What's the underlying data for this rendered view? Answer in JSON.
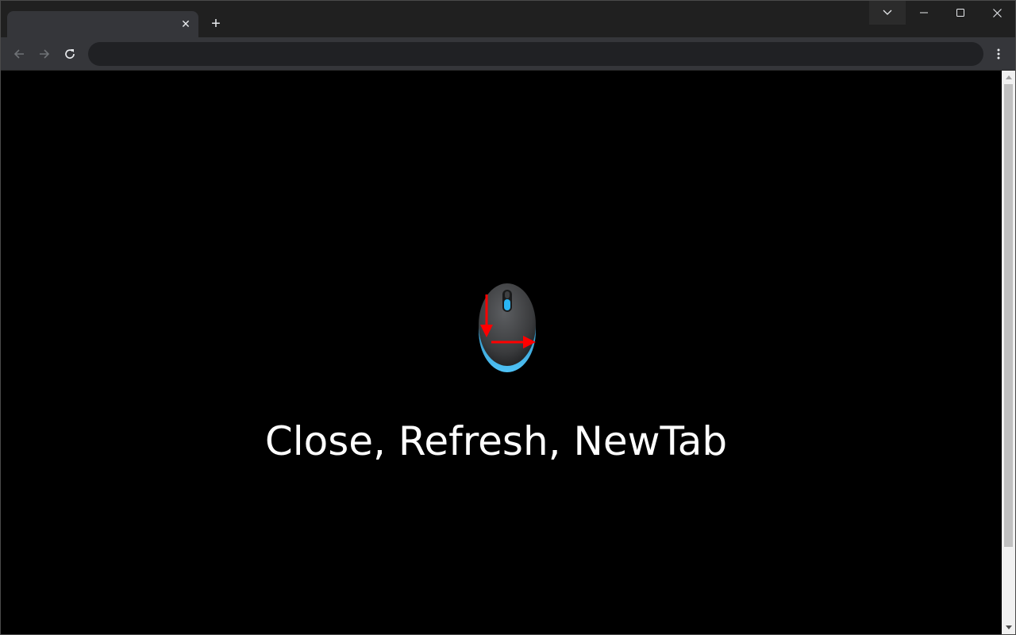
{
  "tab": {
    "title": "",
    "close_glyph": "✕"
  },
  "new_tab_glyph": "+",
  "window_controls": [
    "tab-search",
    "minimize",
    "maximize",
    "close"
  ],
  "toolbar": {
    "back_icon": "back-arrow-icon",
    "forward_icon": "forward-arrow-icon",
    "reload_icon": "reload-icon",
    "address_value": "",
    "menu_icon": "kebab-menu-icon"
  },
  "content": {
    "caption": "Close, Refresh, NewTab",
    "graphic": "mouse-gesture-icon",
    "gesture_color": "#ff0000",
    "accent_color": "#29b6f6"
  }
}
